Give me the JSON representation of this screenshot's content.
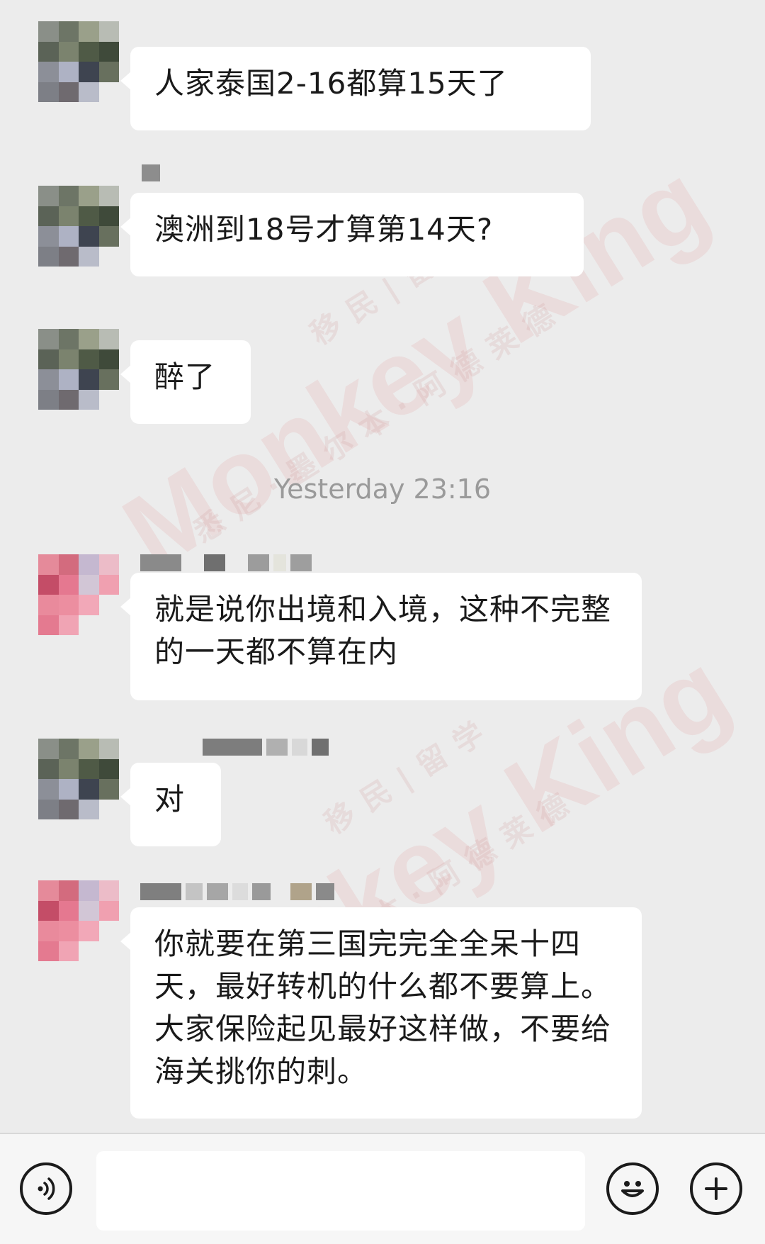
{
  "timestamp": "Yesterday 23:16",
  "watermark": {
    "brand": "Monkey King",
    "sub_top": "移民|留学",
    "sub_bottom": "悉尼·墨尔本·阿德莱德"
  },
  "messages": [
    {
      "text": "人家泰国2-16都算15天了"
    },
    {
      "text": "澳洲到18号才算第14天?"
    },
    {
      "text": "醉了"
    },
    {
      "text": "就是说你出境和入境，这种不完整的一天都不算在内"
    },
    {
      "text": "对"
    },
    {
      "text": "你就要在第三国完完全全呆十四天，最好转机的什么都不要算上。大家保险起见最好这样做，不要给海关挑你的刺。"
    }
  ],
  "input": {
    "placeholder": ""
  },
  "icons": {
    "voice": "voice-icon",
    "emoji": "emoji-icon",
    "plus": "plus-icon"
  }
}
